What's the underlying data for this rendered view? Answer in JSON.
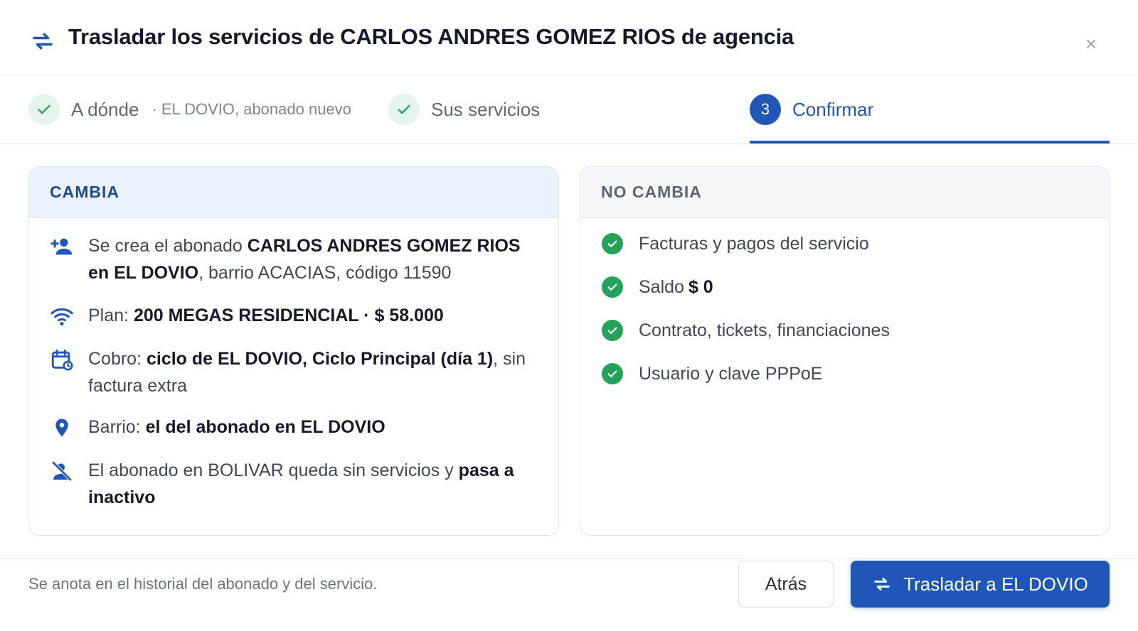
{
  "header": {
    "icon": "swap-arrows-icon",
    "title": "Trasladar los servicios de CARLOS ANDRES GOMEZ RIOS de agencia",
    "close": "×"
  },
  "steps": [
    {
      "label": "A dónde",
      "sub": "· EL DOVIO, abonado nuevo",
      "status": "done"
    },
    {
      "label": "Sus servicios",
      "status": "done"
    },
    {
      "number": "3",
      "label": "Confirmar",
      "status": "active"
    }
  ],
  "cambia": {
    "title": "CAMBIA",
    "rows": [
      {
        "icon": "person-add-icon",
        "parts": [
          {
            "t": "Se crea el abonado ",
            "b": false
          },
          {
            "t": "CARLOS ANDRES GOMEZ RIOS en EL DOVIO",
            "b": true
          },
          {
            "t": ", barrio ACACIAS, código 11590",
            "b": false
          }
        ]
      },
      {
        "icon": "wifi-icon",
        "parts": [
          {
            "t": "Plan: ",
            "b": false
          },
          {
            "t": "200 MEGAS RESIDENCIAL · $ 58.000",
            "b": true
          }
        ]
      },
      {
        "icon": "calendar-cycle-icon",
        "parts": [
          {
            "t": "Cobro: ",
            "b": false
          },
          {
            "t": "ciclo de EL DOVIO, Ciclo Principal (día 1)",
            "b": true
          },
          {
            "t": ", sin factura extra",
            "b": false
          }
        ]
      },
      {
        "icon": "location-pin-icon",
        "parts": [
          {
            "t": "Barrio: ",
            "b": false
          },
          {
            "t": "el del abonado en EL DOVIO",
            "b": true
          }
        ]
      },
      {
        "icon": "person-off-icon",
        "parts": [
          {
            "t": "El abonado en BOLIVAR queda sin servicios y ",
            "b": false
          },
          {
            "t": "pasa a inactivo",
            "b": true
          }
        ]
      }
    ]
  },
  "no_cambia": {
    "title": "NO CAMBIA",
    "rows": [
      {
        "text": "Facturas y pagos del servicio"
      },
      {
        "text": "Saldo",
        "strong": "$ 0"
      },
      {
        "text": "Contrato, tickets, financiaciones"
      },
      {
        "text": "Usuario y clave PPPoE"
      }
    ]
  },
  "footer": {
    "note": "Se anota en el historial del abonado y del servicio.",
    "back_label": "Atrás",
    "confirm_label": "Trasladar a EL DOVIO"
  },
  "colors": {
    "primary": "#1f56b8",
    "success": "#23a35a",
    "cambia_header_bg": "#e8f1fc"
  }
}
